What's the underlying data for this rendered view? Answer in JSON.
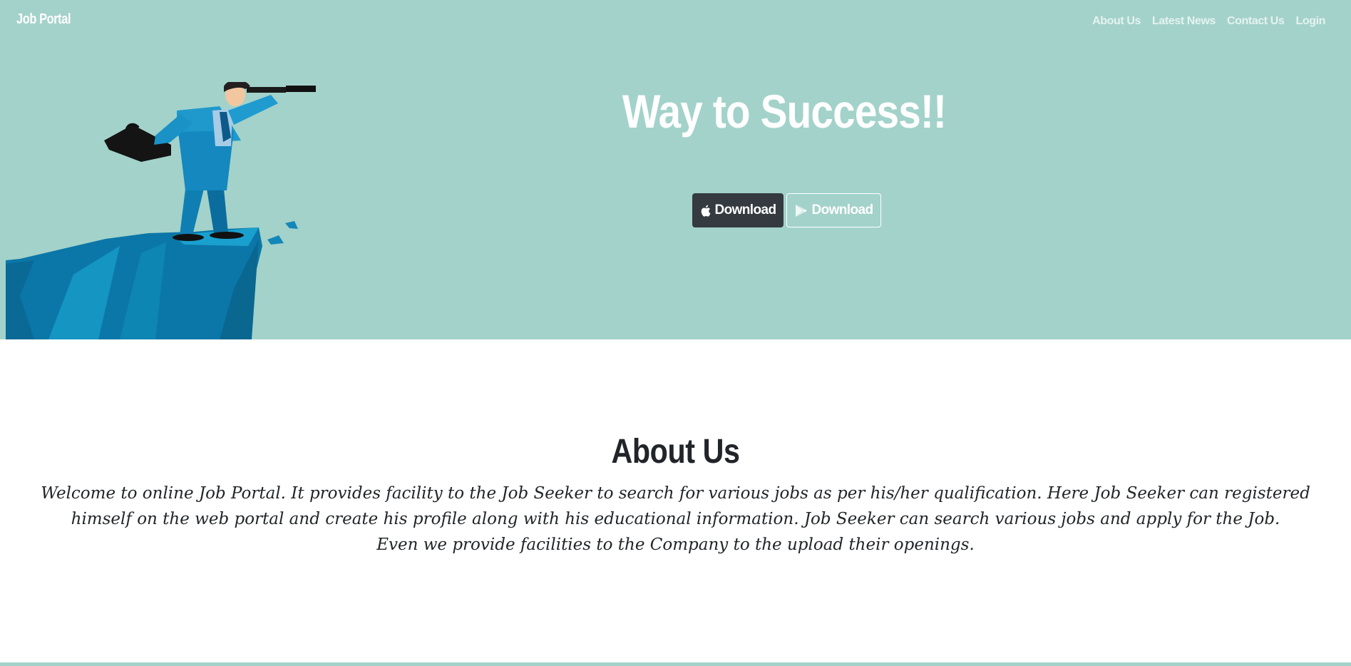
{
  "navbar": {
    "brand": "Job Portal",
    "links": [
      "About Us",
      "Latest News",
      "Contact Us",
      "Login"
    ]
  },
  "hero": {
    "title": "Way to Success!!",
    "buttons": [
      {
        "label": "Download",
        "icon": "apple-icon",
        "style": "dark"
      },
      {
        "label": "Download",
        "icon": "google-play-icon",
        "style": "outline"
      }
    ],
    "illustration": "businessman-with-telescope-on-cliff"
  },
  "about": {
    "title": "About Us",
    "lines": [
      "Welcome to online Job Portal. It provides facility to the Job Seeker to search for various jobs as per his/her qualification. Here Job Seeker can registered himself on the web portal and create his profile along with his educational information. Job Seeker can search various jobs and apply for the Job.",
      "Even we provide facilities to the Company to the upload their openings."
    ]
  },
  "colors": {
    "hero_bg": "#a3d2ca",
    "dark_button": "#343a40",
    "text_dark": "#212529",
    "cliff_blue": "#0b77a8"
  }
}
